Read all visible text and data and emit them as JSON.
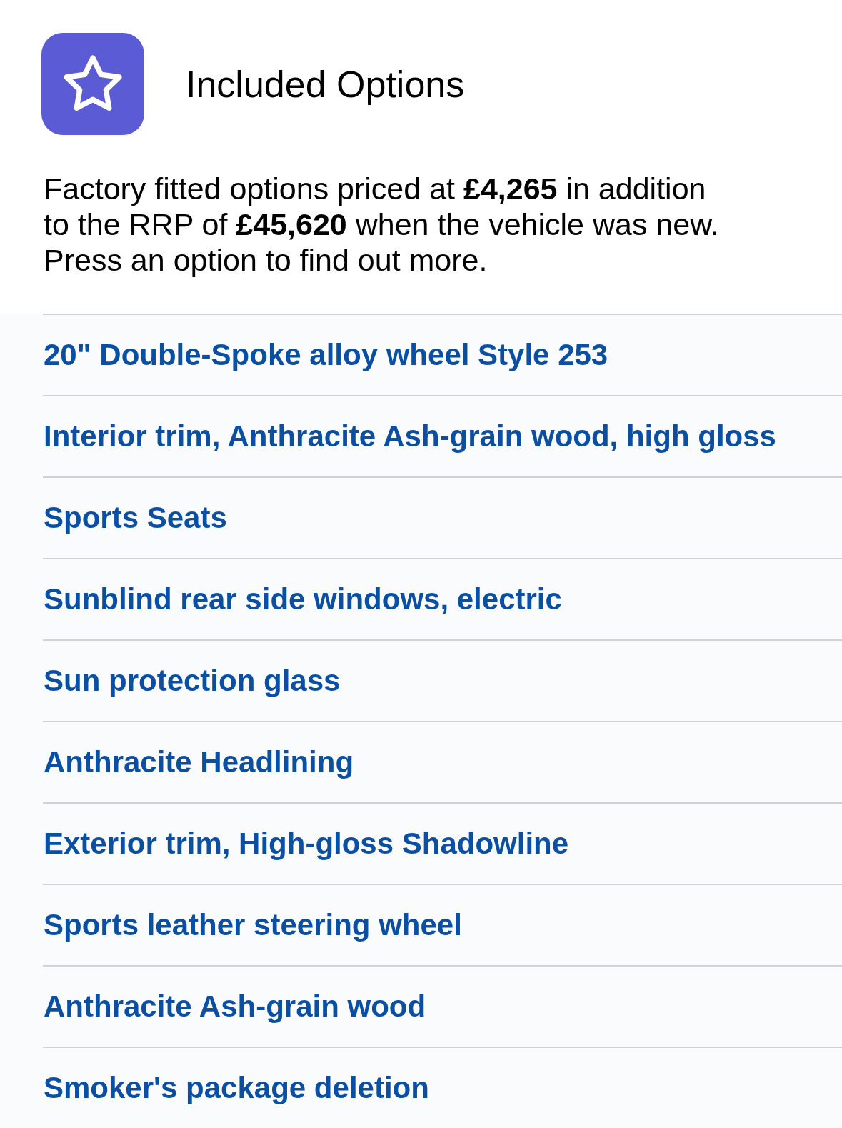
{
  "header": {
    "title": "Included Options"
  },
  "intro": {
    "lines": [
      "Factory fitted options priced at **£4,265** in addition",
      "to the RRP of **£45,620** when the vehicle was new.",
      "Press an option to find out more."
    ]
  },
  "options": [
    "20\" Double-Spoke alloy wheel Style 253",
    "Interior trim, Anthracite Ash-grain wood, high gloss",
    "Sports Seats",
    "Sunblind rear side windows, electric",
    "Sun protection glass",
    "Anthracite Headlining",
    "Exterior trim, High-gloss Shadowline",
    "Sports leather steering wheel",
    "Anthracite Ash-grain wood",
    "Smoker's package deletion"
  ]
}
